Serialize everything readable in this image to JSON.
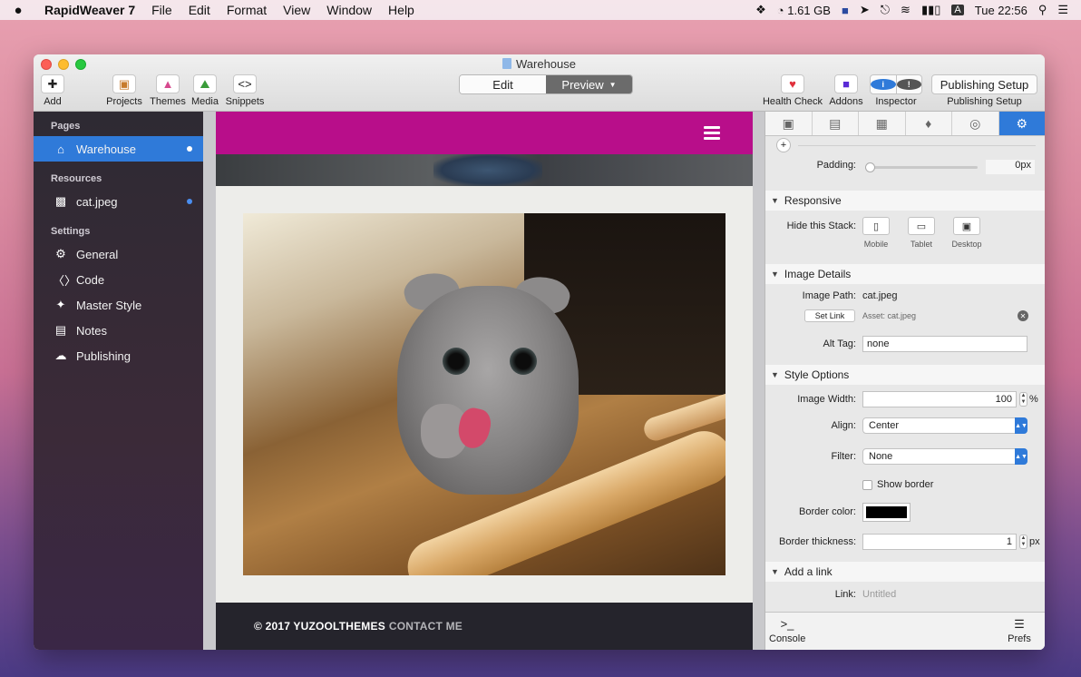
{
  "menubar": {
    "apple": "",
    "app_name": "RapidWeaver 7",
    "menus": [
      "File",
      "Edit",
      "Format",
      "View",
      "Window",
      "Help"
    ],
    "memory": "1.61 GB",
    "clock": "Tue 22:56"
  },
  "window": {
    "title": "Warehouse",
    "toolbar": {
      "add": "Add",
      "projects": "Projects",
      "themes": "Themes",
      "media": "Media",
      "snippets": "Snippets",
      "edit": "Edit",
      "preview": "Preview",
      "health_check": "Health Check",
      "addons": "Addons",
      "inspector": "Inspector",
      "publishing_setup_button": "Publishing Setup",
      "publishing_setup_label": "Publishing Setup"
    }
  },
  "sidebar": {
    "pages_header": "Pages",
    "pages": [
      {
        "label": "Warehouse",
        "icon": "home-icon"
      }
    ],
    "resources_header": "Resources",
    "resources": [
      {
        "label": "cat.jpeg",
        "icon": "file-icon"
      }
    ],
    "settings_header": "Settings",
    "settings": [
      {
        "label": "General",
        "icon": "gear-icon"
      },
      {
        "label": "Code",
        "icon": "code-icon"
      },
      {
        "label": "Master Style",
        "icon": "wand-icon"
      },
      {
        "label": "Notes",
        "icon": "notes-icon"
      },
      {
        "label": "Publishing",
        "icon": "cloud-icon"
      }
    ]
  },
  "site": {
    "footer_copyright": "© 2017 YUZOOLTHEMES",
    "footer_link": "CONTACT ME"
  },
  "inspector": {
    "padding_label": "Padding:",
    "padding_value": "0px",
    "responsive": {
      "header": "Responsive",
      "hide_label": "Hide this Stack:",
      "mobile": "Mobile",
      "tablet": "Tablet",
      "desktop": "Desktop"
    },
    "image_details": {
      "header": "Image Details",
      "path_label": "Image Path:",
      "path_value": "cat.jpeg",
      "set_link": "Set Link",
      "asset": "Asset: cat.jpeg",
      "alt_label": "Alt Tag:",
      "alt_value": "none"
    },
    "style_options": {
      "header": "Style Options",
      "width_label": "Image Width:",
      "width_value": "100",
      "width_unit": "%",
      "align_label": "Align:",
      "align_value": "Center",
      "filter_label": "Filter:",
      "filter_value": "None",
      "show_border": "Show border",
      "border_color_label": "Border color:",
      "border_color": "#000000",
      "border_thickness_label": "Border thickness:",
      "border_thickness_value": "1",
      "border_thickness_unit": "px"
    },
    "add_link": {
      "header": "Add a link",
      "link_label": "Link:",
      "link_placeholder": "Untitled"
    },
    "console": "Console",
    "prefs": "Prefs"
  },
  "colors": {
    "accent": "#2f7ad9",
    "site_nav": "#b80e8a",
    "footer": "#25242c"
  }
}
